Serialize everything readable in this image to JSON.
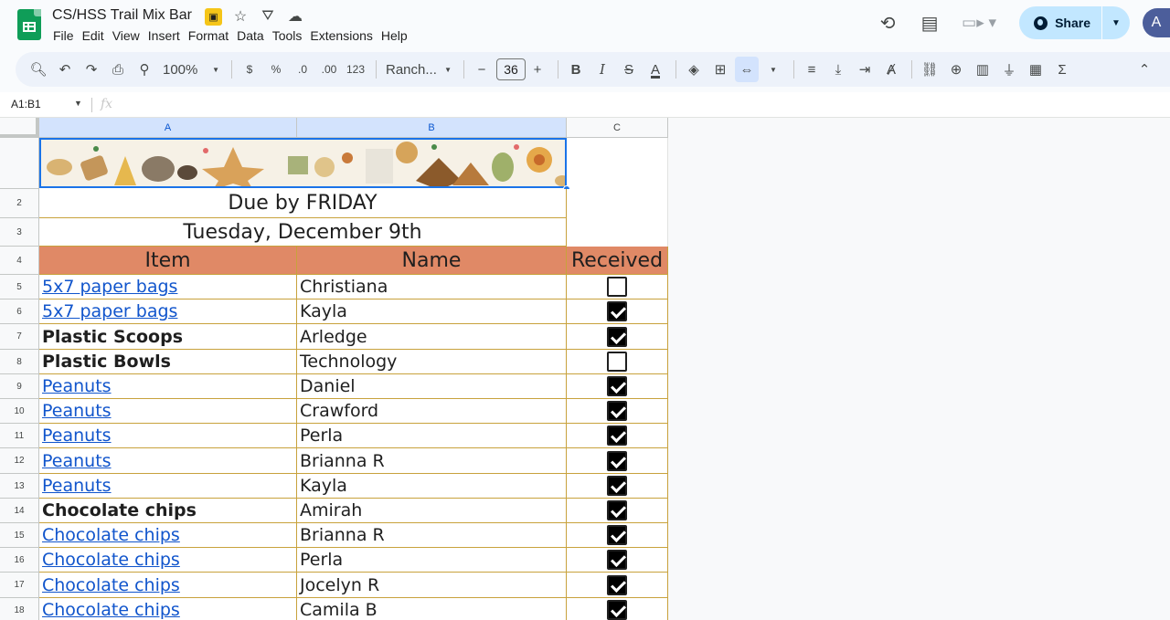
{
  "app": {
    "title": "CS/HSS Trail Mix Bar",
    "menu": [
      "File",
      "Edit",
      "View",
      "Insert",
      "Format",
      "Data",
      "Tools",
      "Extensions",
      "Help"
    ],
    "share_label": "Share",
    "avatar_letter": "A"
  },
  "toolbar": {
    "zoom": "100%",
    "currency": "$",
    "percent": "%",
    "dec_decrease": ".0",
    "dec_increase": ".00",
    "number_format": "123",
    "font": "Ranch...",
    "font_size": "36",
    "bold": "B",
    "italic": "I",
    "strike": "S",
    "text_color": "A",
    "sum": "Σ"
  },
  "formula_bar": {
    "name_box": "A1:B1",
    "fx": "fx"
  },
  "columns": [
    "A",
    "B",
    "C"
  ],
  "sheet": {
    "due": "Due by FRIDAY",
    "date": "Tuesday, December 9th",
    "headers": [
      "Item",
      "Name",
      "Received"
    ],
    "header_color": "#e08966",
    "rows": [
      {
        "num": "5",
        "item": "5x7 paper bags",
        "link": true,
        "name": "Christiana",
        "received": false
      },
      {
        "num": "6",
        "item": "5x7 paper bags",
        "link": true,
        "name": "Kayla",
        "received": true
      },
      {
        "num": "7",
        "item": "Plastic Scoops",
        "link": false,
        "name": "Arledge",
        "received": true
      },
      {
        "num": "8",
        "item": "Plastic Bowls",
        "link": false,
        "name": "Technology",
        "received": false
      },
      {
        "num": "9",
        "item": "Peanuts",
        "link": true,
        "name": "Daniel",
        "received": true
      },
      {
        "num": "10",
        "item": "Peanuts",
        "link": true,
        "name": "Crawford",
        "received": true
      },
      {
        "num": "11",
        "item": "Peanuts",
        "link": true,
        "name": "Perla",
        "received": true
      },
      {
        "num": "12",
        "item": "Peanuts",
        "link": true,
        "name": "Brianna R",
        "received": true
      },
      {
        "num": "13",
        "item": "Peanuts",
        "link": true,
        "name": "Kayla",
        "received": true
      },
      {
        "num": "14",
        "item": "Chocolate chips",
        "link": false,
        "name": "Amirah",
        "received": true
      },
      {
        "num": "15",
        "item": "Chocolate chips",
        "link": true,
        "name": "Brianna R",
        "received": true
      },
      {
        "num": "16",
        "item": "Chocolate chips",
        "link": true,
        "name": "Perla",
        "received": true
      },
      {
        "num": "17",
        "item": "Chocolate chips",
        "link": true,
        "name": "Jocelyn R",
        "received": true
      },
      {
        "num": "18",
        "item": "Chocolate chips",
        "link": true,
        "name": "Camila B",
        "received": true
      }
    ]
  }
}
